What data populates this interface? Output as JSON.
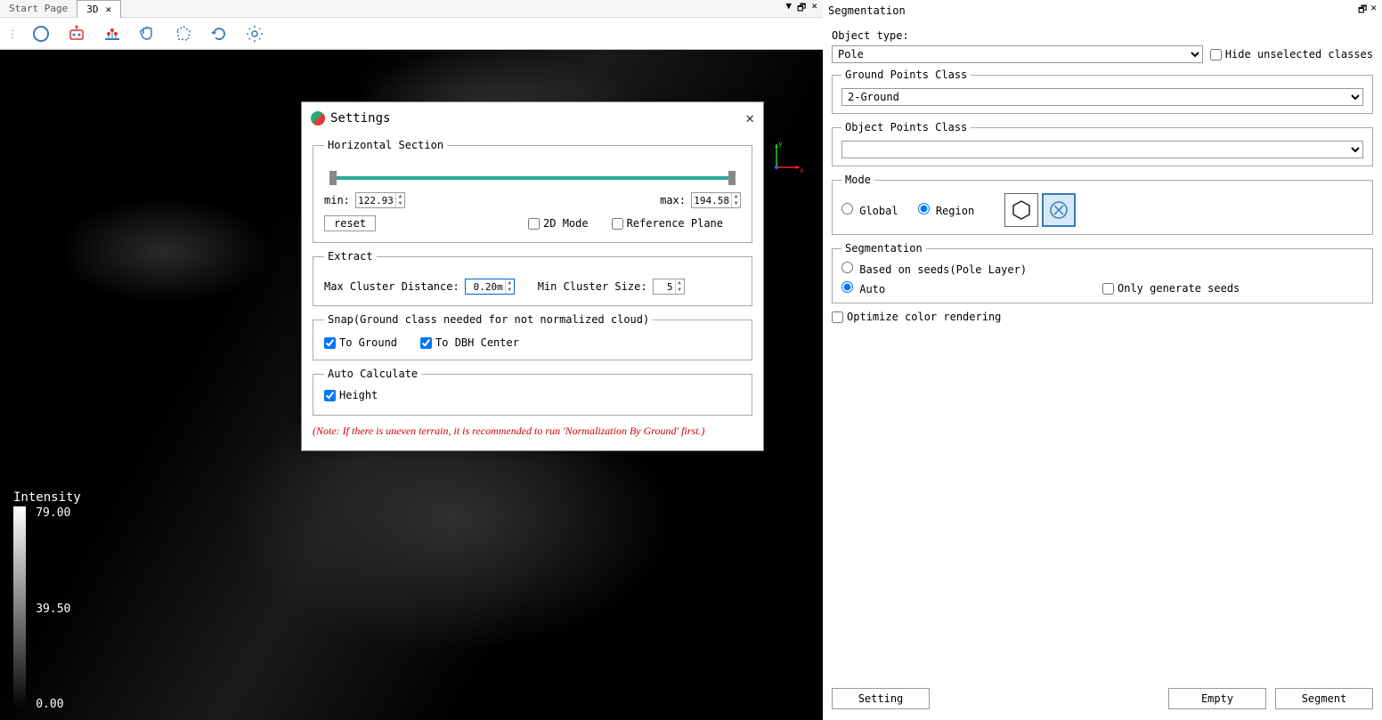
{
  "tabs": {
    "start": "Start Page",
    "active": "3D"
  },
  "tabbar_icons": {
    "dropdown": "▼",
    "popout": "🗗",
    "close": "✕"
  },
  "toolbar": {
    "circle": "circle-select",
    "robot": "auto",
    "align": "align",
    "hand": "pan",
    "polygon": "polygon",
    "refresh": "refresh",
    "gear": "settings"
  },
  "intensity": {
    "title": "Intensity",
    "max": "79.00",
    "mid": "39.50",
    "min": "0.00"
  },
  "settings": {
    "title": "Settings",
    "horizontal": {
      "legend": "Horizontal Section",
      "min_label": "min:",
      "min_value": "122.93",
      "max_label": "max:",
      "max_value": "194.58",
      "reset": "reset",
      "mode2d": "2D Mode",
      "refplane": "Reference Plane"
    },
    "extract": {
      "legend": "Extract",
      "maxdist_label": "Max Cluster Distance:",
      "maxdist_value": "0.20m",
      "minsize_label": "Min Cluster Size:",
      "minsize_value": "5"
    },
    "snap": {
      "legend": "Snap(Ground class needed for not normalized cloud)",
      "to_ground": "To Ground",
      "to_dbh": "To DBH Center"
    },
    "autocalc": {
      "legend": "Auto Calculate",
      "height": "Height"
    },
    "note": "(Note: If there is uneven terrain, it is recommended to run 'Normalization By Ground' first.)"
  },
  "panel": {
    "title": "Segmentation",
    "object_type_label": "Object type:",
    "object_type_value": "Pole",
    "hide_unselected": "Hide unselected classes",
    "ground_class": {
      "legend": "Ground Points Class",
      "value": "2-Ground"
    },
    "object_class": {
      "legend": "Object Points Class",
      "value": ""
    },
    "mode": {
      "legend": "Mode",
      "global": "Global",
      "region": "Region"
    },
    "segmentation": {
      "legend": "Segmentation",
      "seeds": "Based on seeds(Pole Layer)",
      "auto": "Auto",
      "only_generate": "Only generate seeds"
    },
    "optimize": "Optimize color rendering",
    "buttons": {
      "setting": "Setting",
      "empty": "Empty",
      "segment": "Segment"
    }
  }
}
